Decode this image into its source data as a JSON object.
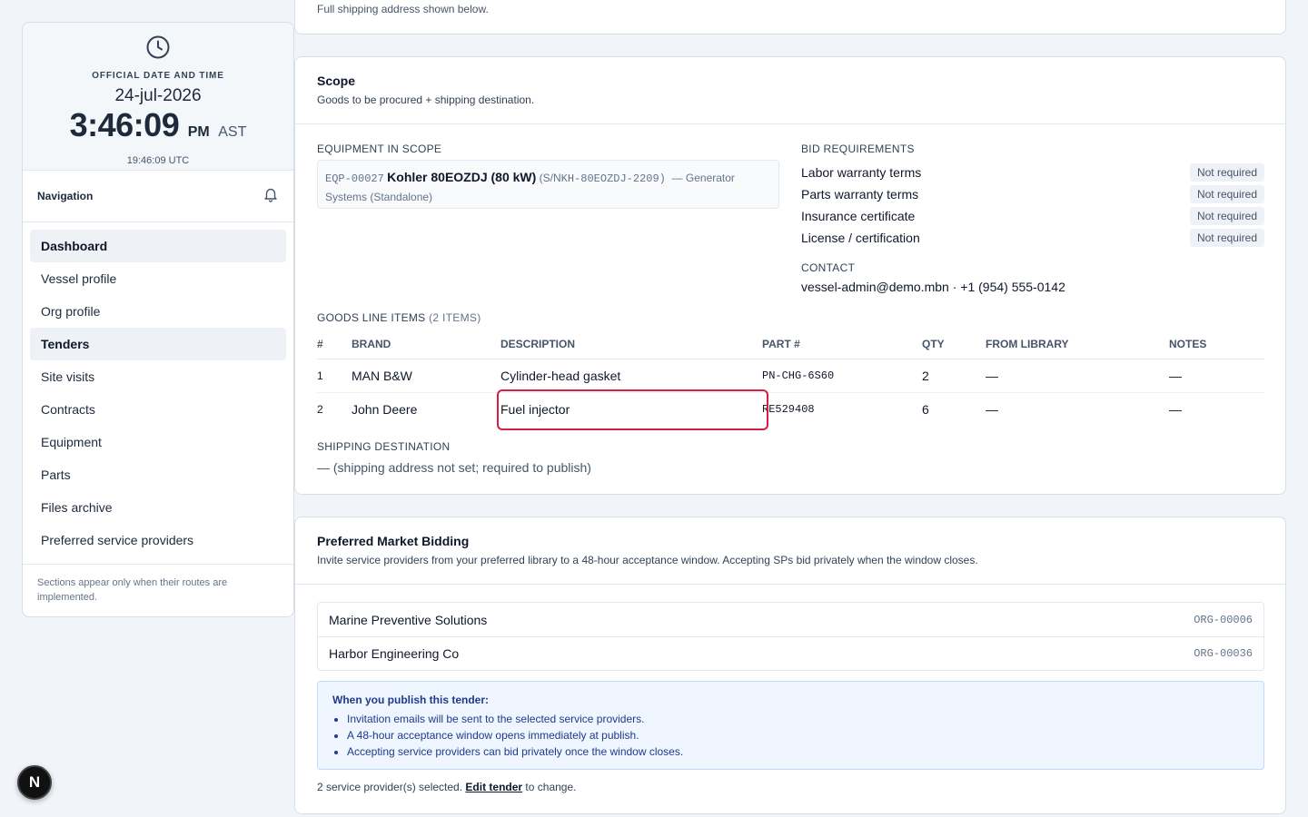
{
  "clock": {
    "label": "OFFICIAL DATE AND TIME",
    "date": "24-jul-2026",
    "time": "3:46:09",
    "ampm": "PM",
    "tz": "AST",
    "utc": "19:46:09 UTC"
  },
  "nav": {
    "title": "Navigation",
    "items": [
      {
        "label": "Dashboard"
      },
      {
        "label": "Vessel profile"
      },
      {
        "label": "Org profile"
      },
      {
        "label": "Tenders"
      },
      {
        "label": "Site visits"
      },
      {
        "label": "Contracts"
      },
      {
        "label": "Equipment"
      },
      {
        "label": "Parts"
      },
      {
        "label": "Files archive"
      },
      {
        "label": "Preferred service providers"
      }
    ],
    "note": "Sections appear only when their routes are implemented."
  },
  "top_card": {
    "text": "Full shipping address shown below."
  },
  "scope": {
    "title": "Scope",
    "subtitle": "Goods to be procured + shipping destination.",
    "equipment_label": "EQUIPMENT IN SCOPE",
    "equipment": {
      "id": "EQP-00027",
      "name": "Kohler 80EOZDJ (80 kW)",
      "sn_prefix": "(S/N",
      "sn": "KH-80EOZDJ-2209)",
      "category": "— Generator Systems (Standalone)"
    },
    "bid_label": "BID REQUIREMENTS",
    "bid_requirements": [
      {
        "label": "Labor warranty terms",
        "status": "Not required"
      },
      {
        "label": "Parts warranty terms",
        "status": "Not required"
      },
      {
        "label": "Insurance certificate",
        "status": "Not required"
      },
      {
        "label": "License / certification",
        "status": "Not required"
      }
    ],
    "contact_label": "CONTACT",
    "contact": "vessel-admin@demo.mbn · +1 (954) 555-0142",
    "goods_label": "GOODS LINE ITEMS",
    "goods_count": "(2 ITEMS)",
    "columns": [
      "#",
      "BRAND",
      "DESCRIPTION",
      "PART #",
      "QTY",
      "FROM LIBRARY",
      "NOTES"
    ],
    "rows": [
      {
        "idx": "1",
        "brand": "MAN B&W",
        "desc": "Cylinder-head gasket",
        "part": "PN-CHG-6S60",
        "qty": "2",
        "lib": "—",
        "notes": "—"
      },
      {
        "idx": "2",
        "brand": "John Deere",
        "desc": "Fuel injector",
        "part": "RE529408",
        "qty": "6",
        "lib": "—",
        "notes": "—"
      }
    ],
    "shipping_label": "SHIPPING DESTINATION",
    "shipping_value": "— (shipping address not set; required to publish)"
  },
  "pmb": {
    "title": "Preferred Market Bidding",
    "subtitle": "Invite service providers from your preferred library to a 48-hour acceptance window. Accepting SPs bid privately when the window closes.",
    "providers": [
      {
        "name": "Marine Preventive Solutions",
        "org": "ORG-00006"
      },
      {
        "name": "Harbor Engineering Co",
        "org": "ORG-00036"
      }
    ],
    "info_title": "When you publish this tender:",
    "info_items": [
      "Invitation emails will be sent to the selected service providers.",
      "A 48-hour acceptance window opens immediately at publish.",
      "Accepting service providers can bid privately once the window closes."
    ],
    "footer_prefix": "2 service provider(s) selected.",
    "footer_link": "Edit tender",
    "footer_suffix": "to change."
  },
  "badge": {
    "letter": "N"
  }
}
